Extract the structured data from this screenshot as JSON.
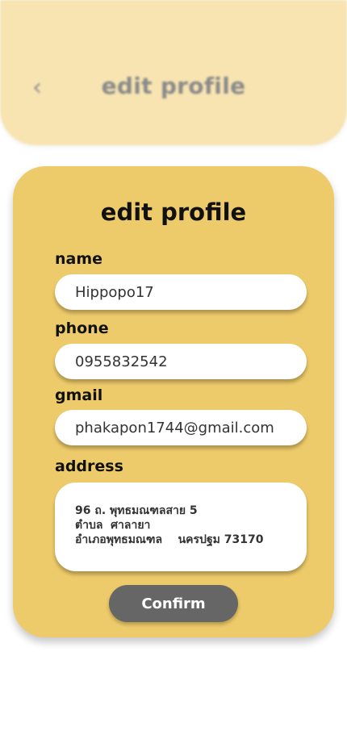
{
  "background_header": {
    "back_icon": "chevron-left-icon",
    "title": "edit profile"
  },
  "card": {
    "title": "edit profile",
    "fields": {
      "name": {
        "label": "name",
        "value": "Hippopo17"
      },
      "phone": {
        "label": "phone",
        "value": "0955832542"
      },
      "gmail": {
        "label": "gmail",
        "value": "phakapon1744@gmail.com"
      },
      "address": {
        "label": "address",
        "lines": [
          "96 ถ. พุทธมณฑลสาย 5",
          "ตำบล  ศาลายา",
          "อำเภอพุทธมณฑล    นครปฐม 73170"
        ]
      }
    },
    "confirm_label": "Confirm"
  },
  "colors": {
    "header_bg": "#f7e4b1",
    "card_bg": "#eecb6a",
    "button_bg": "#666666",
    "field_bg": "#ffffff"
  }
}
